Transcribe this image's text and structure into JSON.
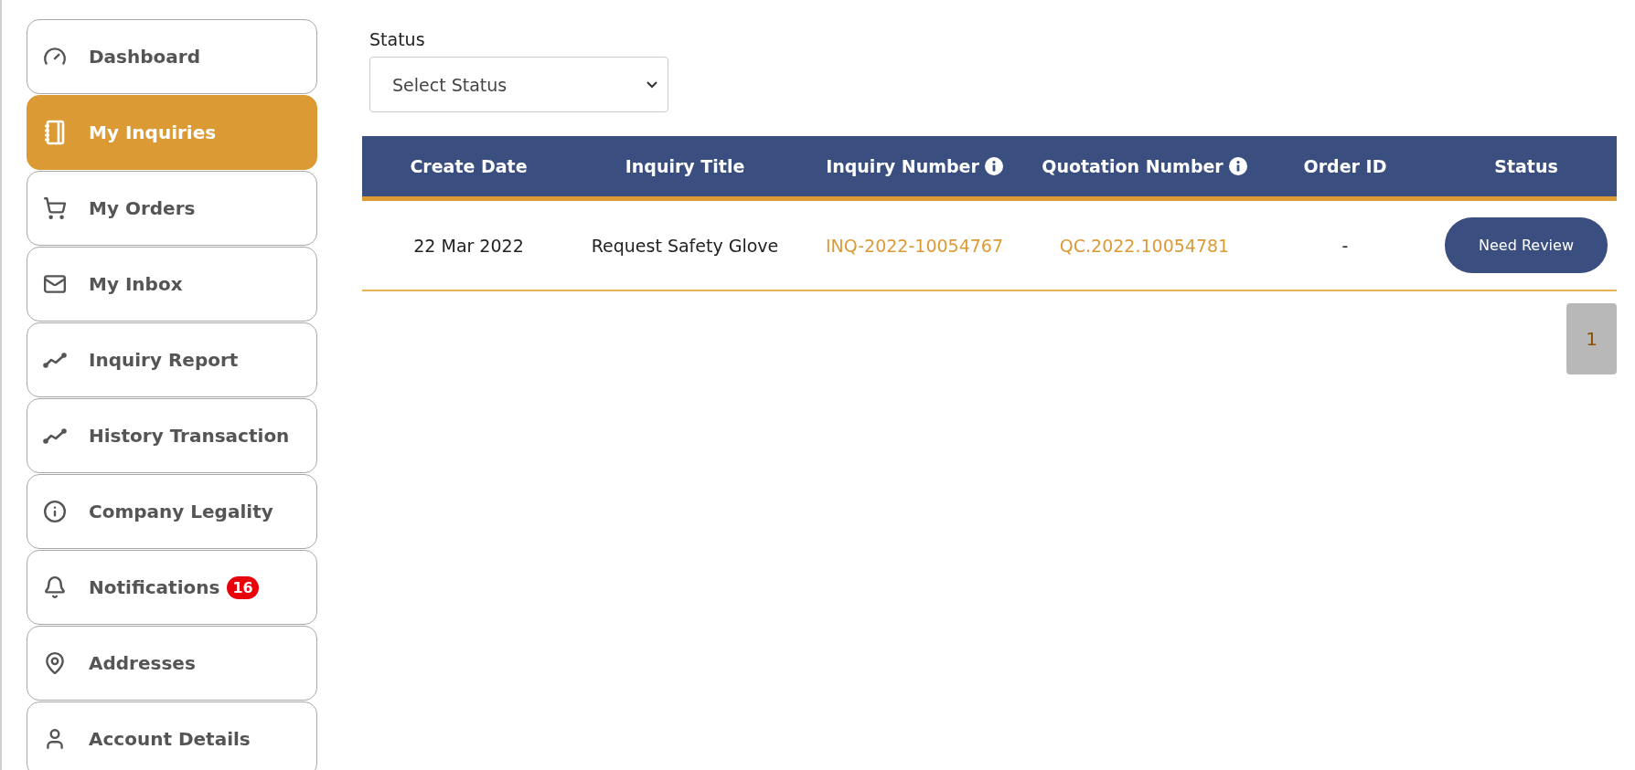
{
  "sidebar": {
    "items": [
      {
        "label": "Dashboard",
        "selected": false
      },
      {
        "label": "My Inquiries",
        "selected": true
      },
      {
        "label": "My Orders",
        "selected": false
      },
      {
        "label": "My Inbox",
        "selected": false
      },
      {
        "label": "Inquiry Report",
        "selected": false
      },
      {
        "label": "History Transaction",
        "selected": false
      },
      {
        "label": "Company Legality",
        "selected": false
      },
      {
        "label": "Notifications",
        "selected": false,
        "badge": "16"
      },
      {
        "label": "Addresses",
        "selected": false
      },
      {
        "label": "Account Details",
        "selected": false
      }
    ]
  },
  "filter": {
    "label": "Status",
    "placeholder": "Select Status"
  },
  "table": {
    "columns": [
      {
        "label": "Create Date",
        "info": false
      },
      {
        "label": "Inquiry Title",
        "info": false
      },
      {
        "label": "Inquiry Number",
        "info": true
      },
      {
        "label": "Quotation Number",
        "info": true
      },
      {
        "label": "Order ID",
        "info": false
      },
      {
        "label": "Status",
        "info": false
      }
    ],
    "rows": [
      {
        "cells": [
          {
            "kind": "text",
            "text": "22 Mar 2022"
          },
          {
            "kind": "text",
            "text": "Request Safety Glove"
          },
          {
            "kind": "link",
            "text": "INQ-2022-10054767"
          },
          {
            "kind": "link",
            "text": "QC.2022.10054781"
          },
          {
            "kind": "text",
            "text": "-"
          },
          {
            "kind": "status",
            "text": "Need Review"
          }
        ]
      }
    ]
  },
  "pagination": {
    "pages": [
      {
        "label": "1",
        "selected": true
      }
    ]
  }
}
